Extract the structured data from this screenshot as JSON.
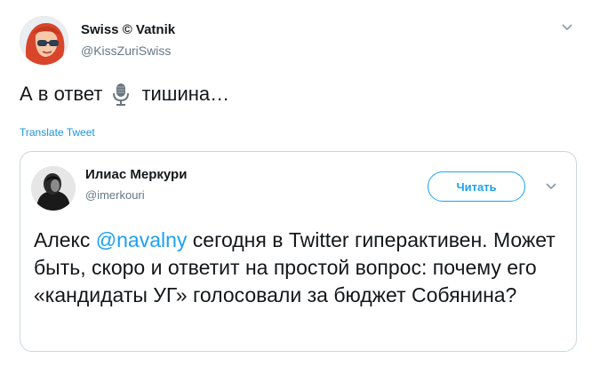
{
  "tweet": {
    "author_name": "Swiss © Vatnik",
    "author_handle": "@KissZuriSwiss",
    "text_before": "А в ответ",
    "text_emoji": "microphone-emoji",
    "text_after": "тишина…",
    "translate_label": "Translate Tweet",
    "menu_icon": "chevron-down-icon"
  },
  "quote": {
    "author_name": "Илиас Меркури",
    "author_handle": "@imerkouri",
    "follow_label": "Читать",
    "text_prefix": "Алекс ",
    "mention": "@navalny",
    "text_suffix": " сегодня в Twitter гиперактивен. Может быть, скоро и ответит на простой вопрос: почему его «кандидаты УГ» голосовали за бюджет Собянина?",
    "menu_icon": "chevron-down-icon"
  },
  "colors": {
    "link": "#1da1f2",
    "secondary_text": "#657786",
    "border": "#ccd6dd"
  }
}
